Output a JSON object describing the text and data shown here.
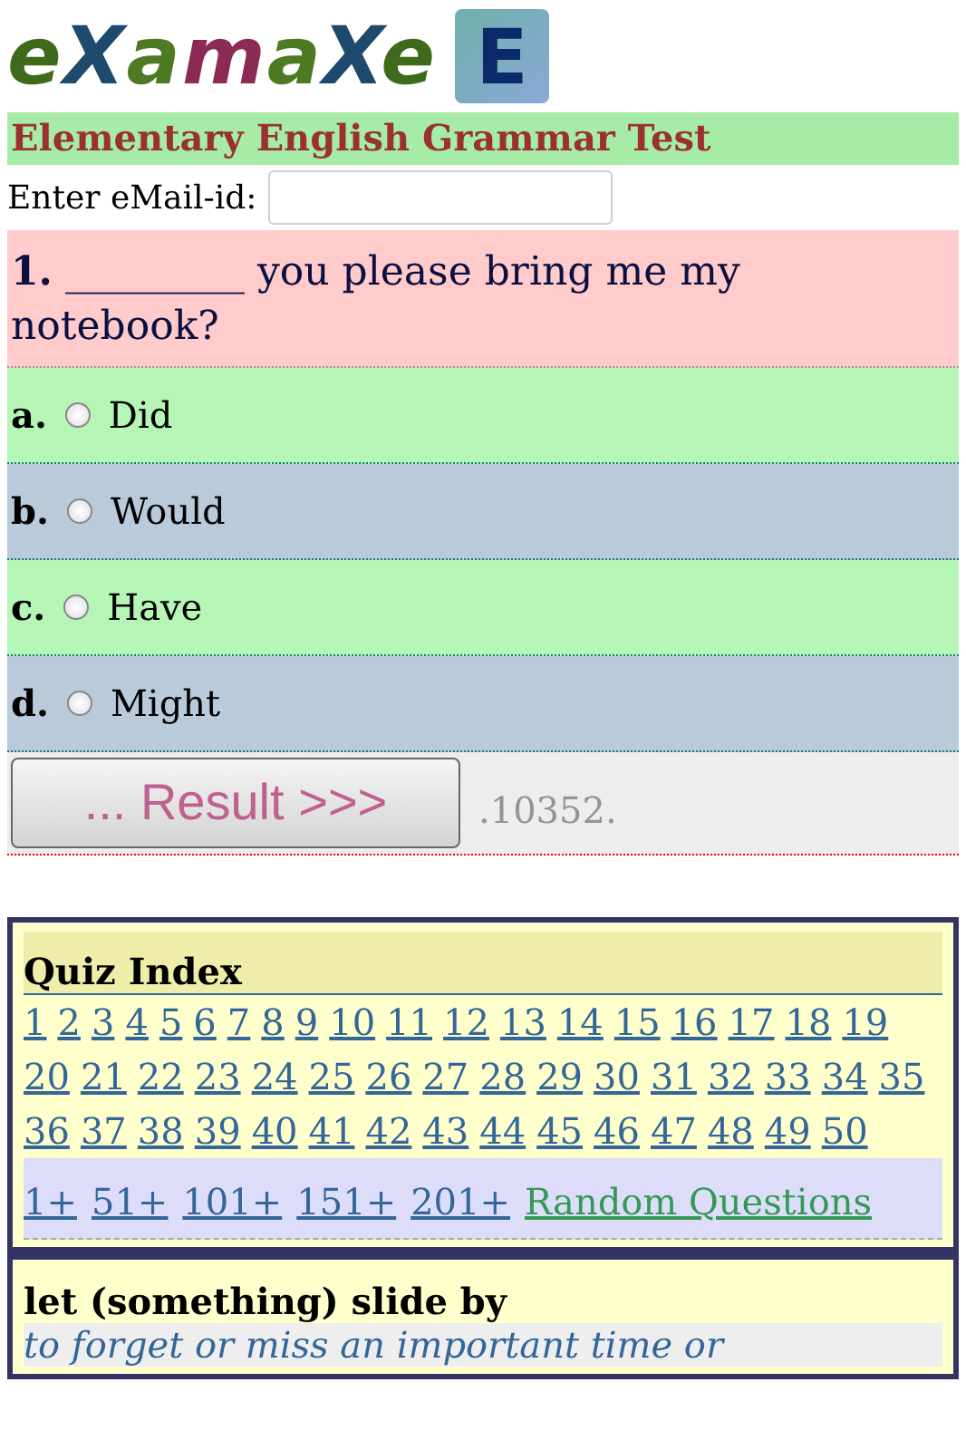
{
  "logo": {
    "text": "eXamaXe",
    "badge": "E"
  },
  "title": "Elementary English Grammar Test",
  "email": {
    "label": "Enter eMail-id:"
  },
  "question": {
    "number": "1.",
    "text": "_________ you please bring me my notebook?"
  },
  "options": [
    {
      "letter": "a.",
      "label": "Did",
      "selected": false
    },
    {
      "letter": "b.",
      "label": "Would",
      "selected": false
    },
    {
      "letter": "c.",
      "label": "Have",
      "selected": false
    },
    {
      "letter": "d.",
      "label": "Might",
      "selected": false
    }
  ],
  "result_button": "... Result >>>",
  "counter": ".10352.",
  "quiz_index": {
    "title": "Quiz Index",
    "links": [
      "1",
      "2",
      "3",
      "4",
      "5",
      "6",
      "7",
      "8",
      "9",
      "10",
      "11",
      "12",
      "13",
      "14",
      "15",
      "16",
      "17",
      "18",
      "19",
      "20",
      "21",
      "22",
      "23",
      "24",
      "25",
      "26",
      "27",
      "28",
      "29",
      "30",
      "31",
      "32",
      "33",
      "34",
      "35",
      "36",
      "37",
      "38",
      "39",
      "40",
      "41",
      "42",
      "43",
      "44",
      "45",
      "46",
      "47",
      "48",
      "49",
      "50"
    ],
    "ranges": [
      "1+",
      "51+",
      "101+",
      "151+",
      "201+"
    ],
    "random": "Random Questions"
  },
  "idiom": {
    "phrase": "let (something) slide by",
    "meaning": "to forget or miss an important time or"
  }
}
